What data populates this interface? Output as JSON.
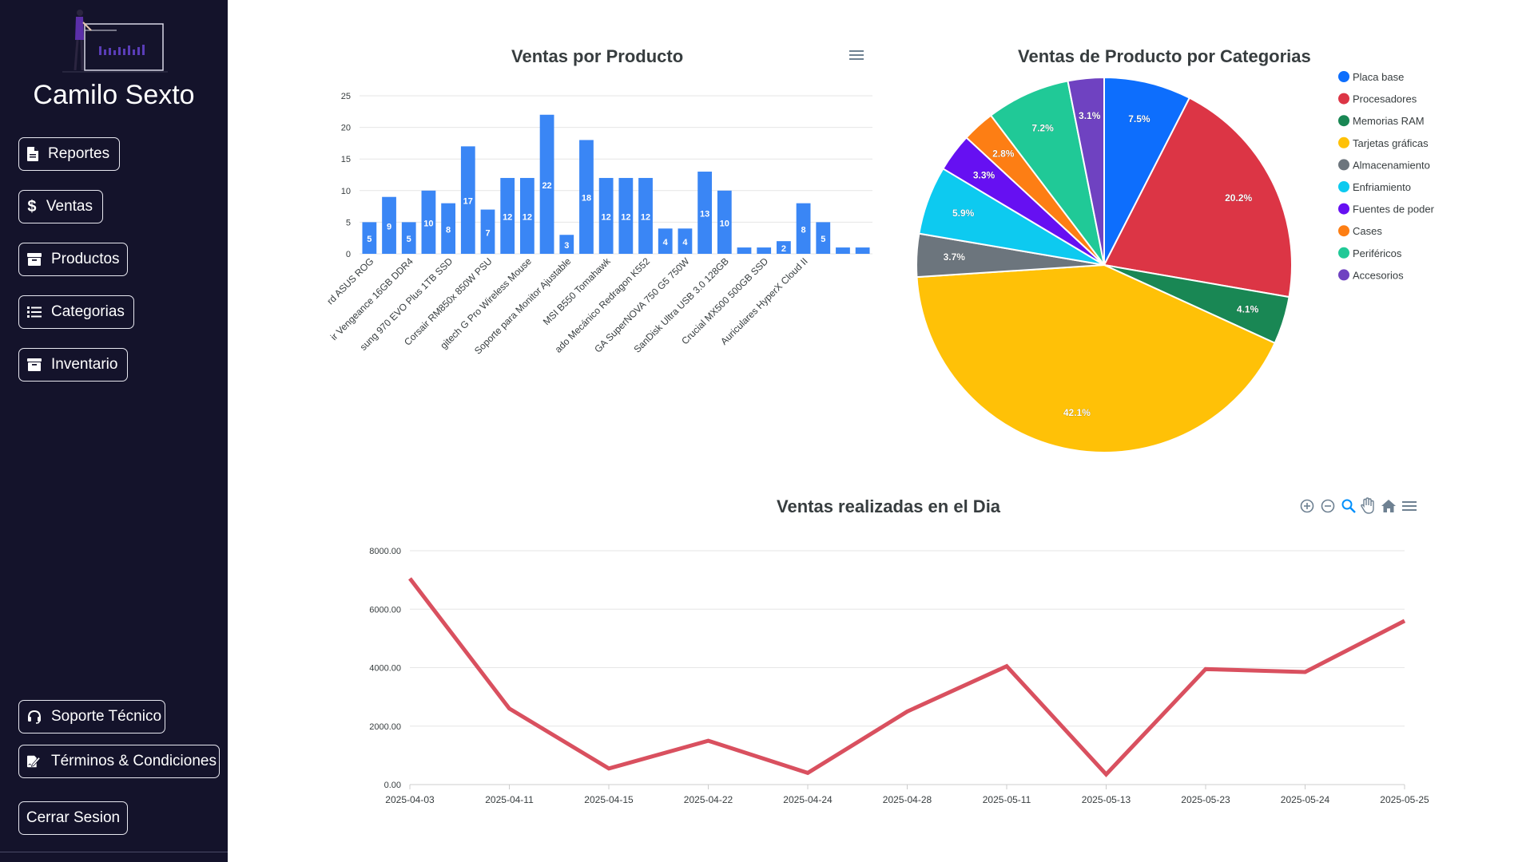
{
  "sidebar": {
    "brand": "Camilo Sexto",
    "nav": [
      {
        "label": "Reportes",
        "icon": "file-icon"
      },
      {
        "label": "Ventas",
        "icon": "dollar-icon"
      },
      {
        "label": "Productos",
        "icon": "box-icon"
      },
      {
        "label": "Categorias",
        "icon": "list-icon"
      },
      {
        "label": "Inventario",
        "icon": "archive-icon"
      }
    ],
    "bottom": [
      {
        "label": "Soporte Técnico",
        "icon": "headset-icon"
      },
      {
        "label": "Términos & Condiciones",
        "icon": "signature-icon"
      },
      {
        "label": "Cerrar Sesion"
      }
    ]
  },
  "charts": {
    "bar_title": "Ventas por Producto",
    "pie_title": "Ventas de Producto por Categorias",
    "line_title": "Ventas realizadas en el Dia"
  },
  "chart_data": [
    {
      "type": "bar",
      "title": "Ventas por Producto",
      "ylim": [
        0,
        25
      ],
      "yticks": [
        "0",
        "5",
        "10",
        "15",
        "20",
        "25"
      ],
      "color": "#3a86f5",
      "values": [
        5,
        9,
        5,
        10,
        8,
        17,
        7,
        12,
        12,
        22,
        3,
        18,
        12,
        12,
        12,
        4,
        4,
        13,
        10,
        1,
        1,
        2,
        8,
        5,
        1,
        1
      ],
      "shown_labels": [
        "5",
        "9",
        "5",
        "10",
        "8",
        "17",
        "7",
        "12",
        "12",
        "22",
        "3",
        "18",
        "12",
        "12",
        "12",
        "4",
        "4",
        "13",
        "10",
        "",
        "",
        "2",
        "8",
        "5",
        "",
        ""
      ],
      "tick_labels": [
        {
          "text": "rd ASUS ROG",
          "index": 0
        },
        {
          "text": "ir Vengeance 16GB DDR4",
          "index": 2
        },
        {
          "text": "sung 970 EVO Plus 1TB SSD",
          "index": 4
        },
        {
          "text": "Corsair RM850x 850W PSU",
          "index": 6
        },
        {
          "text": "gitech G Pro Wireless Mouse",
          "index": 8
        },
        {
          "text": "Soporte para Monitor Ajustable",
          "index": 10
        },
        {
          "text": "MSI B550 Tomahawk",
          "index": 12
        },
        {
          "text": "ado Mecánico Redragon K552",
          "index": 14
        },
        {
          "text": "GA SuperNOVA 750 G5 750W",
          "index": 16
        },
        {
          "text": "SanDisk Ultra USB 3.0 128GB",
          "index": 18
        },
        {
          "text": "Crucial MX500 500GB SSD",
          "index": 20
        },
        {
          "text": "Auriculares HyperX Cloud II",
          "index": 22
        }
      ]
    },
    {
      "type": "pie",
      "title": "Ventas de Producto por Categorias",
      "legend_position": "right",
      "slices": [
        {
          "name": "Placa base",
          "value": 7.5,
          "label": "7.5%",
          "color": "#0d6efd"
        },
        {
          "name": "Procesadores",
          "value": 20.2,
          "label": "20.2%",
          "color": "#dc3545"
        },
        {
          "name": "Memorias RAM",
          "value": 4.1,
          "label": "4.1%",
          "color": "#198754"
        },
        {
          "name": "Tarjetas gráficas",
          "value": 42.1,
          "label": "42.1%",
          "color": "#ffc107"
        },
        {
          "name": "Almacenamiento",
          "value": 3.7,
          "label": "3.7%",
          "color": "#6c757d"
        },
        {
          "name": "Enfriamiento",
          "value": 5.9,
          "label": "5.9%",
          "color": "#0dcaf0"
        },
        {
          "name": "Fuentes de poder",
          "value": 3.3,
          "label": "3.3%",
          "color": "#6610f2"
        },
        {
          "name": "Cases",
          "value": 2.8,
          "label": "2.8%",
          "color": "#fd7e14"
        },
        {
          "name": "Periféricos",
          "value": 7.2,
          "label": "7.2%",
          "color": "#20c997"
        },
        {
          "name": "Accesorios",
          "value": 3.1,
          "label": "3.1%",
          "color": "#6f42c1"
        }
      ]
    },
    {
      "type": "line",
      "title": "Ventas realizadas en el Dia",
      "color": "#d9505f",
      "ylim": [
        0,
        8000
      ],
      "yticks": [
        "0.00",
        "2000.00",
        "4000.00",
        "6000.00",
        "8000.00"
      ],
      "x": [
        "2025-04-03",
        "2025-04-11",
        "2025-04-15",
        "2025-04-22",
        "2025-04-24",
        "2025-04-28",
        "2025-05-11",
        "2025-05-13",
        "2025-05-23",
        "2025-05-24",
        "2025-05-25"
      ],
      "y": [
        7050,
        2600,
        550,
        1500,
        400,
        2500,
        4050,
        350,
        3950,
        3850,
        5600
      ]
    }
  ]
}
